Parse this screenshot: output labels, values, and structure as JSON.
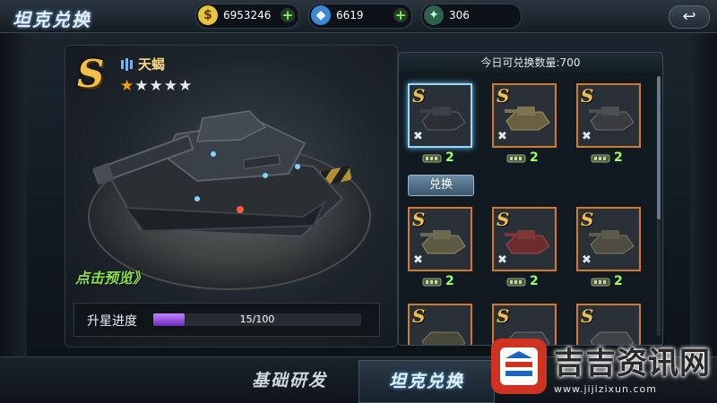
{
  "header": {
    "title": "坦克兑换",
    "close_label": "↩",
    "resources": [
      {
        "icon": "gold-coin-icon",
        "value": "6953246"
      },
      {
        "icon": "diamond-icon",
        "value": "6619"
      },
      {
        "icon": "medal-icon",
        "value": "306"
      }
    ]
  },
  "tank": {
    "rank": "S",
    "type_icon": "tank-class-icon",
    "name": "天蝎",
    "stars_filled": 1,
    "stars_total": 5,
    "preview_label": "点击预览》",
    "upgrade": {
      "label": "升星进度",
      "current": 15,
      "max": 100,
      "text": "15/100"
    }
  },
  "exchange": {
    "header": "今日可兑换数量:700",
    "button_label": "兑换",
    "items": [
      {
        "rank": "S",
        "cost": "2",
        "selected": true
      },
      {
        "rank": "S",
        "cost": "2",
        "selected": false
      },
      {
        "rank": "S",
        "cost": "2",
        "selected": false
      },
      {
        "rank": "S",
        "cost": "2",
        "selected": false
      },
      {
        "rank": "S",
        "cost": "2",
        "selected": false
      },
      {
        "rank": "S",
        "cost": "2",
        "selected": false
      },
      {
        "rank": "S",
        "cost": "",
        "selected": false
      },
      {
        "rank": "S",
        "cost": "",
        "selected": false
      },
      {
        "rank": "S",
        "cost": "",
        "selected": false
      }
    ]
  },
  "tabs": [
    {
      "label": "基础研发",
      "active": false
    },
    {
      "label": "坦克兑换",
      "active": true
    }
  ],
  "watermark": {
    "text": "吉吉资讯网",
    "url": "www.jijizixun.com"
  },
  "colors": {
    "accent": "#f0c04b",
    "border": "#d17a2a",
    "green": "#9cff6e",
    "progress": "#9a56e6"
  }
}
